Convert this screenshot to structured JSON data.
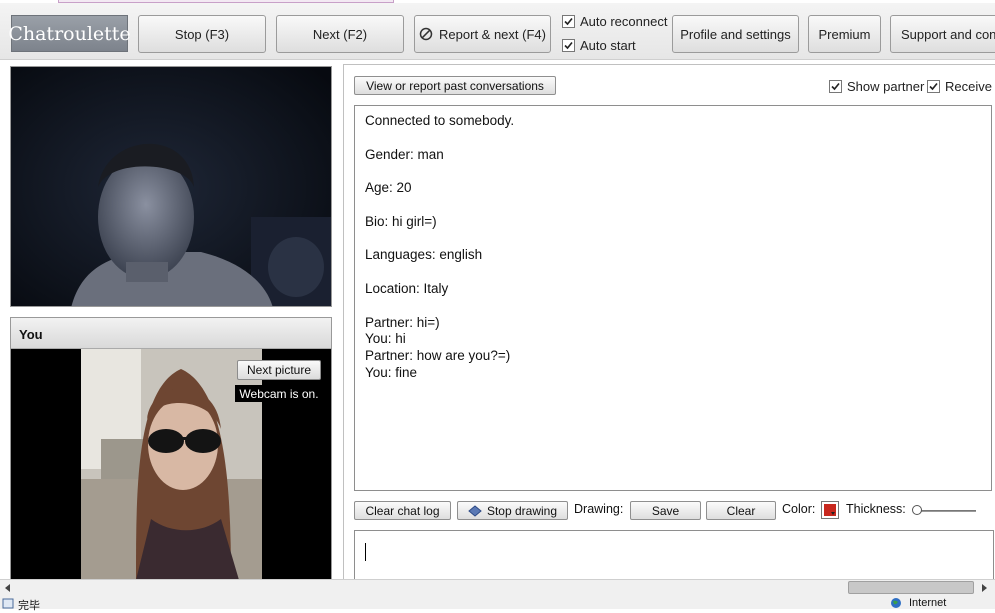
{
  "toolbar": {
    "logo": "Chatroulette",
    "stop_label": "Stop (F3)",
    "next_label": "Next (F2)",
    "report_next_label": "Report & next (F4)",
    "auto_reconnect_label": "Auto reconnect",
    "auto_reconnect_checked": true,
    "auto_start_label": "Auto start",
    "auto_start_checked": true,
    "profile_label": "Profile and settings",
    "premium_label": "Premium",
    "support_label": "Support and cont"
  },
  "you_panel": {
    "title": "You",
    "next_picture_label": "Next picture",
    "webcam_status": "Webcam is on."
  },
  "chat": {
    "past_conversations_label": "View or report past conversations",
    "show_partner_label": "Show partner",
    "show_partner_checked": true,
    "receive_label": "Receive",
    "receive_checked": true,
    "log_lines": [
      "Connected to somebody.",
      "",
      "Gender: man",
      "",
      "Age: 20",
      "",
      "Bio: hi girl=)",
      "",
      "Languages: english",
      "",
      "Location: Italy",
      "",
      "Partner: hi=)",
      "You: hi",
      "Partner: how are you?=)",
      "You: fine"
    ],
    "clear_chat_label": "Clear chat log",
    "stop_drawing_label": "Stop drawing",
    "drawing_label": "Drawing:",
    "save_label": "Save",
    "clear_label": "Clear",
    "color_label": "Color:",
    "thickness_label": "Thickness:",
    "drawing_color": "#c8281e"
  },
  "status_bar": {
    "left_text": "完毕",
    "zone_text": "Internet"
  }
}
